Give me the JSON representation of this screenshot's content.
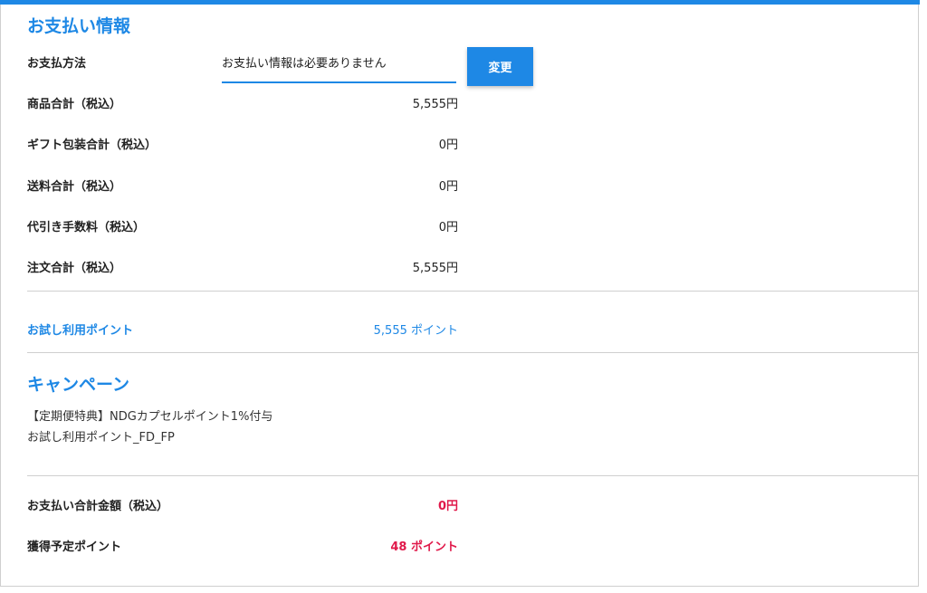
{
  "colors": {
    "accent": "#1e88e5",
    "highlight": "#e0194a",
    "divider": "#cfcfcf"
  },
  "payment": {
    "title": "お支払い情報",
    "method_label": "お支払方法",
    "method_value": "お支払い情報は必要ありません",
    "change_button": "変更",
    "rows": [
      {
        "label": "商品合計（税込）",
        "value": "5,555円"
      },
      {
        "label": "ギフト包装合計（税込）",
        "value": "0円"
      },
      {
        "label": "送料合計（税込）",
        "value": "0円"
      },
      {
        "label": "代引き手数料（税込）",
        "value": "0円"
      },
      {
        "label": "注文合計（税込）",
        "value": "5,555円"
      }
    ],
    "trial_points_label": "お試し利用ポイント",
    "trial_points_value": "5,555 ポイント"
  },
  "campaign": {
    "title": "キャンペーン",
    "lines": [
      "【定期便特典】NDGカプセルポイント1%付与",
      "お試し利用ポイント_FD_FP"
    ]
  },
  "summary": {
    "total_label": "お支払い合計金額（税込）",
    "total_value": "0円",
    "points_label": "獲得予定ポイント",
    "points_value": "48 ポイント"
  }
}
